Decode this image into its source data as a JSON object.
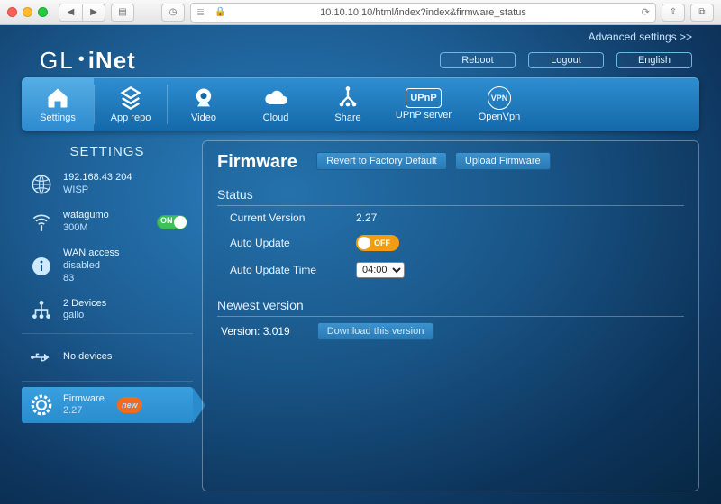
{
  "browser": {
    "url": "10.10.10.10/html/index?index&firmware_status"
  },
  "header": {
    "advanced_link": "Advanced settings >>",
    "logo_gl": "GL",
    "logo_inet": "iNet",
    "buttons": {
      "reboot": "Reboot",
      "logout": "Logout",
      "language": "English"
    }
  },
  "topnav": {
    "settings": "Settings",
    "app_repo": "App repo",
    "video": "Video",
    "cloud": "Cloud",
    "share": "Share",
    "upnp": "UPnP server",
    "upnp_badge": "UPnP",
    "openvpn": "OpenVpn",
    "vpn_badge": "VPN"
  },
  "sidebar": {
    "title": "SETTINGS",
    "internet": {
      "ip": "192.168.43.204",
      "mode": "WISP"
    },
    "wifi": {
      "ssid": "watagumo",
      "rate": "300M",
      "toggle": "ON"
    },
    "wan": {
      "l1": "WAN access",
      "l2": "disabled",
      "l3": "83"
    },
    "lan": {
      "l1": "2 Devices",
      "l2": "gallo"
    },
    "usb": {
      "l1": "No devices"
    },
    "firmware": {
      "l1": "Firmware",
      "l2": "2.27",
      "badge": "new"
    }
  },
  "main": {
    "title": "Firmware",
    "revert_btn": "Revert to Factory Default",
    "upload_btn": "Upload Firmware",
    "status_h": "Status",
    "current_version_k": "Current Version",
    "current_version_v": "2.27",
    "auto_update_k": "Auto Update",
    "auto_update_v": "OFF",
    "auto_update_time_k": "Auto Update Time",
    "auto_update_time_v": "04:00",
    "newest_h": "Newest version",
    "newest_version_k": "Version:",
    "newest_version_v": "3.019",
    "download_btn": "Download this version"
  }
}
